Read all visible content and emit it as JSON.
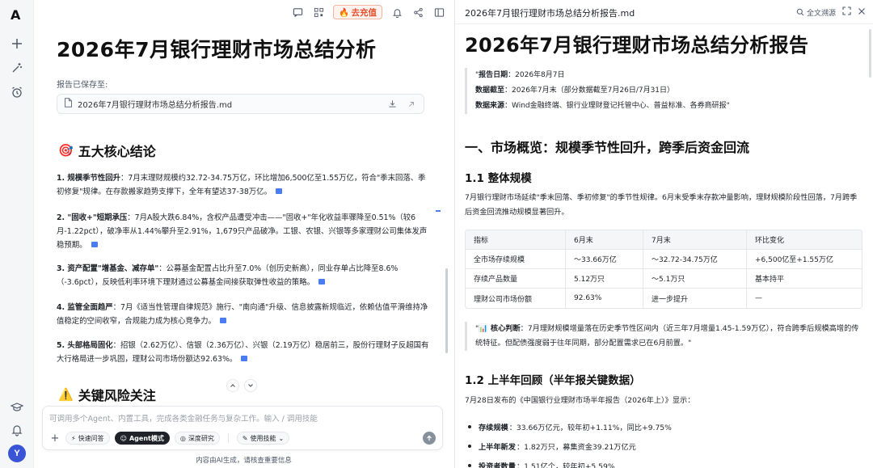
{
  "rail": {
    "logo": "A",
    "avatar": "Y"
  },
  "chat": {
    "topbar": {
      "recharge_label": "去充值"
    },
    "title": "2026年7月银行理财市场总结分析",
    "saved_label": "报告已保存至:",
    "file_name": "2026年7月银行理财市场总结分析报告.md",
    "section1": {
      "emoji": "🎯",
      "title": "五大核心结论"
    },
    "conclusions": [
      {
        "head": "1. 规模季节性回升",
        "body": "：7月末理财规模约32.72-34.75万亿，环比增加6,500亿至1.55万亿，符合\"季末回落、季初修复\"规律。在存款搬家趋势支撑下，全年有望达37-38万亿。"
      },
      {
        "head": "2. \"固收+\"短期承压",
        "body": "：7月A股大跌6.84%，含权产品遭受冲击——\"固收+\"年化收益率骤降至0.51%（较6月-1.22pct），破净率从1.44%攀升至2.91%，1,679只产品破净。工银、农银、兴银等多家理财公司集体发声稳预期。"
      },
      {
        "head": "3. 资产配置\"增基金、减存单\"",
        "body": "：公募基金配置占比升至7.0%（创历史新高），同业存单占比降至8.6%（-3.6pct），反映低利率环境下理财通过公募基金间接获取弹性收益的策略。"
      },
      {
        "head": "4. 监管全面趋严",
        "body": "：7月《适当性管理自律规范》施行、\"南向通\"升级、信息披露新规临近，依赖估值平滑维持净值稳定的空间收窄，合规能力成为核心竞争力。"
      },
      {
        "head": "5. 头部格局固化",
        "body": "：招银（2.62万亿）、信银（2.36万亿）、兴银（2.19万亿）稳居前三，股份行理财子反超国有大行格局进一步巩固，理财公司市场份额达92.63%。"
      }
    ],
    "section2": {
      "emoji": "⚠️",
      "title": "关键风险关注"
    },
    "composer": {
      "placeholder": "可调用多个Agent、内置工具，完成各类金融任务与复杂工作。输入 / 调用技能",
      "quick_qa": "快速问答",
      "agent_mode": "Agent模式",
      "deep_research": "深度研究",
      "use_skill": "使用技能"
    },
    "disclaimer": "内容由AI生成，请核查重要信息"
  },
  "doc": {
    "header_title": "2026年7月银行理财市场总结分析报告.md",
    "source_label": "全文溯源",
    "title": "2026年7月银行理财市场总结分析报告",
    "meta": [
      {
        "k": "报告日期",
        "v": "：2026年8月7日",
        "prefix": "\""
      },
      {
        "k": "数据截至",
        "v": "：2026年7月末（部分数据截至7月26日/7月31日）",
        "prefix": ""
      },
      {
        "k": "数据来源",
        "v": "：Wind金融终端、银行业理财登记托管中心、普益标准、各券商研报\"",
        "prefix": ""
      }
    ],
    "h1": "一、市场概览：规模季节性回升，跨季后资金回流",
    "h2_1": "1.1 整体规模",
    "para1": "7月银行理财市场延续\"季末回落、季初修复\"的季节性规律。6月末受季末存款冲量影响，理财规模阶段性回落，7月跨季后资金回流推动规模显著回升。",
    "table": {
      "headers": [
        "指标",
        "6月末",
        "7月末",
        "环比变化"
      ],
      "rows": [
        [
          "全市场存续规模",
          "～33.66万亿",
          "～32.72-34.75万亿",
          "+6,500亿至+1.55万亿"
        ],
        [
          "存续产品数量",
          "5.12万只",
          "～5.1万只",
          "基本持平"
        ],
        [
          "理财公司市场份额",
          "92.63%",
          "进一步提升",
          "—"
        ]
      ]
    },
    "quote": {
      "prefix": "\"",
      "emoji": "📊",
      "head": " 核心判断",
      "body": "：7月理财规模增量落在历史季节性区间内（近三年7月增量1.45-1.59万亿），符合跨季后规模高增的传统特征。但配债强度弱于往年同期，部分配置需求已在6月前置。\""
    },
    "h2_2": "1.2 上半年回顾（半年报关键数据）",
    "para2": "7月28日发布的《中国银行业理财市场半年报告（2026年上）》显示：",
    "bullets": [
      {
        "k": "存续规模",
        "v": "：33.66万亿元，较年初+1.11%，同比+9.75%"
      },
      {
        "k": "上半年新发",
        "v": "：1.82万只，募集资金39.21万亿元"
      },
      {
        "k": "投资者数量",
        "v": "：1.51亿个，较年初+5.59%"
      }
    ]
  }
}
